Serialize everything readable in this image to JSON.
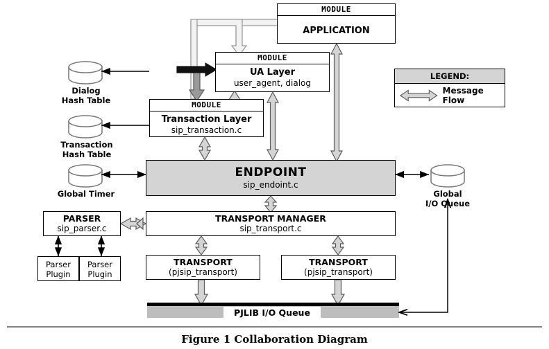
{
  "figure": {
    "caption": "Figure 1 Collaboration Diagram"
  },
  "legend": {
    "header": "LEGEND:",
    "entry_label": "Message Flow",
    "entry_icon": "double-arrow-horizontal-icon"
  },
  "modules": {
    "application": {
      "header": "MODULE",
      "title": "APPLICATION",
      "subtitle": ""
    },
    "ua_layer": {
      "header": "MODULE",
      "title": "UA Layer",
      "subtitle": "user_agent, dialog"
    },
    "transaction_layer": {
      "header": "MODULE",
      "title": "Transaction Layer",
      "subtitle": "sip_transaction.c"
    },
    "endpoint": {
      "title": "ENDPOINT",
      "subtitle": "sip_endoint.c"
    },
    "parser": {
      "title": "PARSER",
      "subtitle": "sip_parser.c"
    },
    "transport_manager": {
      "title": "TRANSPORT MANAGER",
      "subtitle": "sip_transport.c"
    },
    "transport_left": {
      "title": "TRANSPORT",
      "subtitle": "(pjsip_transport)"
    },
    "transport_right": {
      "title": "TRANSPORT",
      "subtitle": "(pjsip_transport)"
    }
  },
  "plugins": [
    {
      "line1": "Parser",
      "line2": "Plugin"
    },
    {
      "line1": "Parser",
      "line2": "Plugin"
    }
  ],
  "stores": [
    {
      "name": "dialog-hash-table",
      "line1": "Dialog",
      "line2": "Hash Table",
      "icon": "cylinder-datastore-icon"
    },
    {
      "name": "transaction-hash-table",
      "line1": "Transaction",
      "line2": "Hash Table",
      "icon": "cylinder-datastore-icon"
    },
    {
      "name": "global-timer",
      "line1": "Global Timer",
      "line2": "",
      "icon": "cylinder-datastore-icon"
    },
    {
      "name": "global-io-queue",
      "line1": "Global",
      "line2": "I/O Queue",
      "icon": "cylinder-datastore-icon"
    }
  ],
  "io_queue_bar": {
    "label": "PJLIB I/O Queue"
  },
  "colors": {
    "arrow_fill": "#d4d4d4",
    "arrow_stroke": "#595959",
    "arrow_fill_dark": "#9a9a9a",
    "endpoint_fill": "#d4d4d4",
    "legend_header_fill": "#d4d4d4",
    "pjlib_fill": "#bdbdbd",
    "rule": "#808080",
    "ink": "#000000"
  }
}
